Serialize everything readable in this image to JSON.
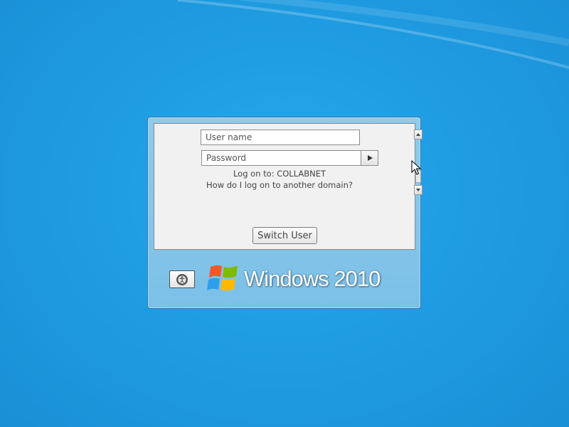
{
  "login": {
    "username_placeholder": "User name",
    "password_placeholder": "Password",
    "logon_to": "Log on to: COLLABNET",
    "other_domain_link": "How do I log on to another domain?",
    "switch_user_label": "Switch User"
  },
  "branding": {
    "brand_text": "Windows 2010"
  },
  "icons": {
    "submit": "arrow-right-icon",
    "ease_of_access": "ease-of-access-icon",
    "logo": "windows-flag-icon",
    "cursor": "mouse-pointer-icon"
  },
  "colors": {
    "desktop_background": "#1f9de3",
    "dialog_frame": "#7cc0e8",
    "panel_background": "#f1f1f1"
  }
}
